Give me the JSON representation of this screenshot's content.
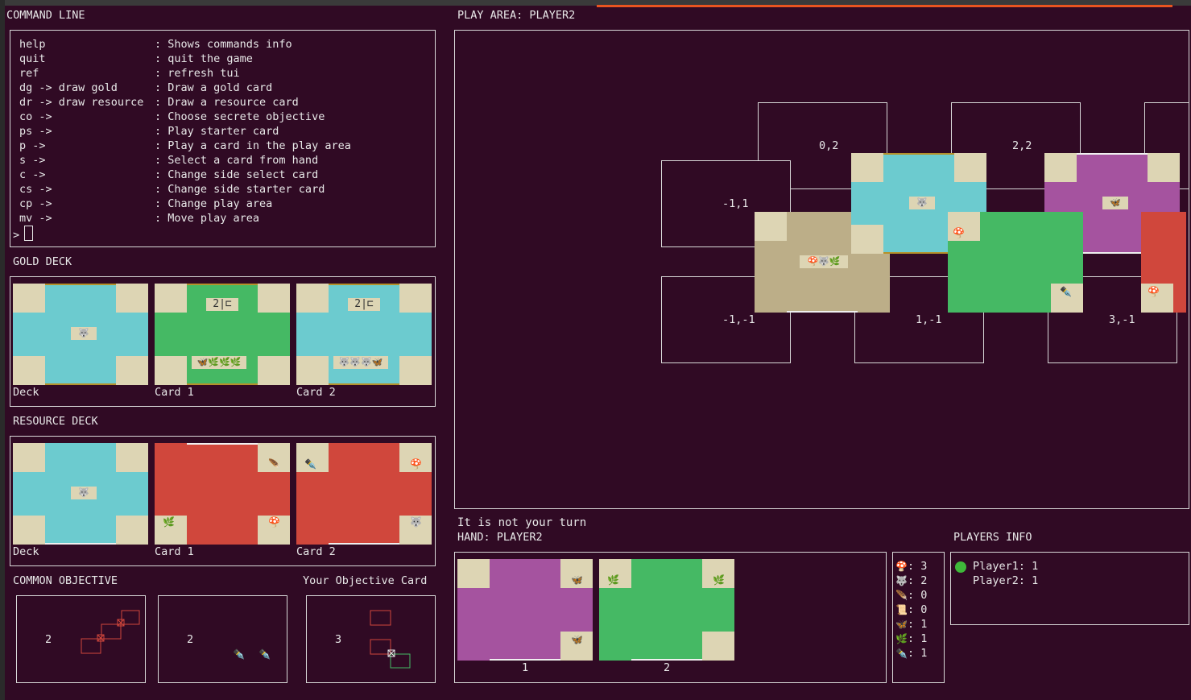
{
  "command_line": {
    "title": "COMMAND LINE",
    "commands": [
      {
        "cmd": "help",
        "desc": ": Shows commands info"
      },
      {
        "cmd": "quit",
        "desc": ": quit the game"
      },
      {
        "cmd": "ref",
        "desc": ": refresh tui"
      },
      {
        "cmd": "dg -> draw gold",
        "desc": ": Draw a gold card"
      },
      {
        "cmd": "dr -> draw resource",
        "desc": ": Draw a resource card"
      },
      {
        "cmd": "co ->",
        "desc": ": Choose secrete objective"
      },
      {
        "cmd": "ps ->",
        "desc": ": Play starter card"
      },
      {
        "cmd": "p ->",
        "desc": ": Play a card in the play area"
      },
      {
        "cmd": "s ->",
        "desc": ": Select a card from hand"
      },
      {
        "cmd": "c ->",
        "desc": ": Change side select card"
      },
      {
        "cmd": "cs ->",
        "desc": ": Change side starter card"
      },
      {
        "cmd": "cp ->",
        "desc": ": Change play area"
      },
      {
        "cmd": "mv ->",
        "desc": ": Move play area"
      }
    ],
    "prompt": ">"
  },
  "gold_deck": {
    "title": "GOLD DECK",
    "labels": [
      "Deck",
      "Card 1",
      "Card 2"
    ],
    "card1_points": "2",
    "card1_req": "🦋🌿🌿🌿",
    "card2_points": "2",
    "card2_req": "🐺🐺🐺🦋"
  },
  "resource_deck": {
    "title": "RESOURCE DECK",
    "labels": [
      "Deck",
      "Card 1",
      "Card 2"
    ]
  },
  "objectives": {
    "common_title": "COMMON OBJECTIVE",
    "your_title": "Your Objective Card",
    "common_points": [
      "2",
      "2"
    ],
    "your_points": "3"
  },
  "play_area": {
    "title": "PLAY AREA: PLAYER2",
    "coords": [
      "0,2",
      "2,2",
      "-1,1",
      "-1,-1",
      "1,-1",
      "3,-1"
    ],
    "starter_center": "🍄🐺🌿"
  },
  "status": {
    "turn_text": "It is not your turn",
    "hand_title": "HAND: PLAYER2",
    "hand_labels": [
      "1",
      "2"
    ]
  },
  "resources": [
    {
      "icon": "🍄",
      "count": "3"
    },
    {
      "icon": "🐺",
      "count": "2"
    },
    {
      "icon": "🪶",
      "count": "0"
    },
    {
      "icon": "📜",
      "count": "0"
    },
    {
      "icon": "🦋",
      "count": "1"
    },
    {
      "icon": "🌿",
      "count": "1"
    },
    {
      "icon": "✒️",
      "count": "1"
    }
  ],
  "players_info": {
    "title": "PLAYERS INFO",
    "players": [
      {
        "name": "Player1",
        "score": "1",
        "active": true
      },
      {
        "name": "Player2",
        "score": "1",
        "active": false
      }
    ]
  },
  "icons": {
    "mushroom": "🍄",
    "wolf": "🐺",
    "feather": "🪶",
    "butterfly": "🦋",
    "leaf": "🌿",
    "quill": "✒️"
  },
  "colors": {
    "background": "#300a24",
    "blue_card": "#6ccbcf",
    "green_card": "#45b964",
    "red_card": "#d0473c",
    "purple_card": "#a5539f",
    "tan_card": "#bcae88",
    "corner": "#ddd5b4"
  }
}
